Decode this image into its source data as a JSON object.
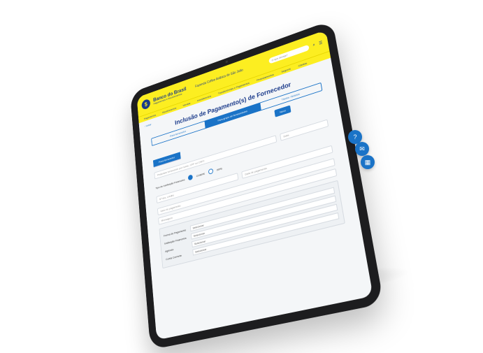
{
  "header": {
    "brand_name": "Banco do Brasil",
    "brand_sub": "Pagamentos e Recebimentos",
    "company": "Fazenda Coffee Arábica de São João",
    "search_placeholder": "O que deseja?"
  },
  "nav": {
    "items": [
      "Pagamentos",
      "Recebimentos",
      "Vendas",
      "Investimentos",
      "Transferências e Pagamentos",
      "Financiamentos",
      "Seguros",
      "Câmbio"
    ]
  },
  "page": {
    "back_label": "Voltar",
    "title": "Inclusão de Pagamento(s) de Fornecedor",
    "tabs": [
      "Para fornecedor",
      "Para grupo de fornecedores",
      "Títulos / Boletos"
    ],
    "new_button": "Novo",
    "subtabs": [
      "Para fornecedor"
    ],
    "search_field": "Pesquisar fornecedor por nome, CPF ou CNPJ",
    "date_field": "Data",
    "type_label": "Tipo de Instituição Financeira",
    "radio_options": [
      "COMPE",
      "ISPB"
    ],
    "fields": [
      "Nº doc. crédito",
      "Valor do pagamento",
      "Data de pagamento",
      "Mensagem"
    ],
    "panel": {
      "rows": [
        {
          "label": "Forma de Pagamento",
          "value": "Selecionar"
        },
        {
          "label": "Instituição Financeira",
          "value": "Selecionar"
        },
        {
          "label": "Agência",
          "value": "Selecionar"
        },
        {
          "label": "Conta Corrente",
          "value": "Selecionar"
        }
      ]
    }
  },
  "fabs": [
    "?",
    "✉",
    "▦"
  ]
}
